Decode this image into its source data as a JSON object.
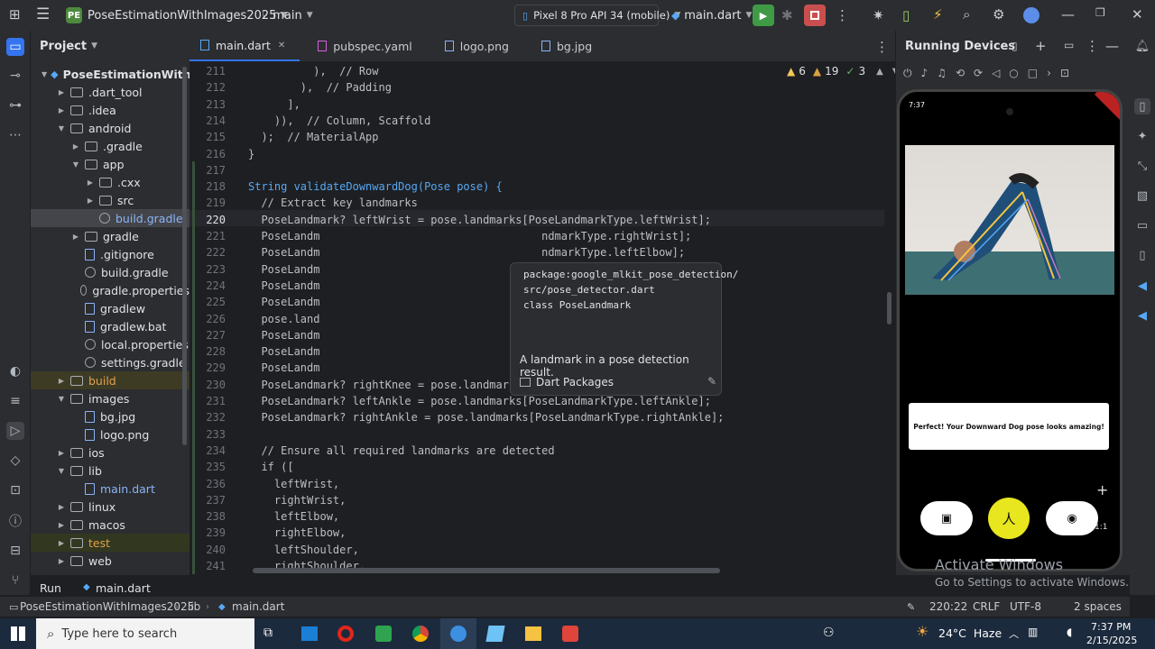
{
  "titlebar": {
    "project_badge": "PE",
    "project_name": "PoseEstimationWithImages2025",
    "branch": "main",
    "device": "Pixel 8 Pro API 34 (mobile)",
    "run_config": "main.dart"
  },
  "project_panel": {
    "title": "Project",
    "root": "PoseEstimationWithIm",
    "items": [
      {
        "label": ".dart_tool",
        "indent": 1,
        "kind": "folder",
        "open": false
      },
      {
        "label": ".idea",
        "indent": 1,
        "kind": "folder",
        "open": false
      },
      {
        "label": "android",
        "indent": 1,
        "kind": "folder",
        "open": true
      },
      {
        "label": ".gradle",
        "indent": 2,
        "kind": "folder",
        "open": false
      },
      {
        "label": "app",
        "indent": 2,
        "kind": "folder",
        "open": true
      },
      {
        "label": ".cxx",
        "indent": 3,
        "kind": "folder",
        "open": false
      },
      {
        "label": "src",
        "indent": 3,
        "kind": "folder",
        "open": false
      },
      {
        "label": "build.gradle",
        "indent": 3,
        "kind": "gradle",
        "open": false
      },
      {
        "label": "gradle",
        "indent": 2,
        "kind": "folder",
        "open": false
      },
      {
        "label": ".gitignore",
        "indent": 2,
        "kind": "file",
        "open": false
      },
      {
        "label": "build.gradle",
        "indent": 2,
        "kind": "gradle",
        "open": false
      },
      {
        "label": "gradle.properties",
        "indent": 2,
        "kind": "gradle",
        "open": false
      },
      {
        "label": "gradlew",
        "indent": 2,
        "kind": "file",
        "open": false
      },
      {
        "label": "gradlew.bat",
        "indent": 2,
        "kind": "file",
        "open": false
      },
      {
        "label": "local.properties",
        "indent": 2,
        "kind": "gradle",
        "open": false
      },
      {
        "label": "settings.gradle",
        "indent": 2,
        "kind": "gradle",
        "open": false
      },
      {
        "label": "build",
        "indent": 1,
        "kind": "folder",
        "open": false
      },
      {
        "label": "images",
        "indent": 1,
        "kind": "folder",
        "open": true
      },
      {
        "label": "bg.jpg",
        "indent": 2,
        "kind": "image",
        "open": false
      },
      {
        "label": "logo.png",
        "indent": 2,
        "kind": "image",
        "open": false
      },
      {
        "label": "ios",
        "indent": 1,
        "kind": "folder",
        "open": false
      },
      {
        "label": "lib",
        "indent": 1,
        "kind": "folder",
        "open": true
      },
      {
        "label": "main.dart",
        "indent": 2,
        "kind": "dart",
        "open": false
      },
      {
        "label": "linux",
        "indent": 1,
        "kind": "folder",
        "open": false
      },
      {
        "label": "macos",
        "indent": 1,
        "kind": "folder",
        "open": false
      },
      {
        "label": "test",
        "indent": 1,
        "kind": "folder",
        "open": false
      },
      {
        "label": "web",
        "indent": 1,
        "kind": "folder",
        "open": false
      }
    ]
  },
  "editor": {
    "tabs": [
      {
        "label": "main.dart",
        "active": true
      },
      {
        "label": "pubspec.yaml",
        "active": false
      },
      {
        "label": "logo.png",
        "active": false
      },
      {
        "label": "bg.jpg",
        "active": false
      }
    ],
    "inspections": {
      "warnings": "6",
      "weak_warnings": "19",
      "typos": "3"
    },
    "lines": [
      {
        "n": "211",
        "code": "          ),  // Row"
      },
      {
        "n": "212",
        "code": "        ),  // Padding"
      },
      {
        "n": "213",
        "code": "      ],"
      },
      {
        "n": "214",
        "code": "    )),  // Column, Scaffold"
      },
      {
        "n": "215",
        "code": "  );  // MaterialApp"
      },
      {
        "n": "216",
        "code": "}"
      },
      {
        "n": "217",
        "code": ""
      },
      {
        "n": "218",
        "code": "String validateDownwardDog(Pose pose) {"
      },
      {
        "n": "219",
        "code": "  // Extract key landmarks"
      },
      {
        "n": "220",
        "code": "  PoseLandmark? leftWrist = pose.landmarks[PoseLandmarkType.leftWrist];"
      },
      {
        "n": "221",
        "code": "  PoseLandm                                  ndmarkType.rightWrist];"
      },
      {
        "n": "222",
        "code": "  PoseLandm                                  ndmarkType.leftElbow];"
      },
      {
        "n": "223",
        "code": "  PoseLandm                                  ndmarkType.rightElbow];"
      },
      {
        "n": "224",
        "code": "  PoseLandm                                   andmarkType.leftShoulder];"
      },
      {
        "n": "225",
        "code": "  PoseLandm"
      },
      {
        "n": "226",
        "code": "  pose.land"
      },
      {
        "n": "227",
        "code": "  PoseLandm                                  Type.leftHip];"
      },
      {
        "n": "228",
        "code": "  PoseLandm                                  rkType.rightHip];"
      },
      {
        "n": "229",
        "code": "  PoseLandm                                   arkType.leftKnee];"
      },
      {
        "n": "230",
        "code": "  PoseLandmark? rightKnee = pose.landmarks[PoseLandmarkType.rightKnee];"
      },
      {
        "n": "231",
        "code": "  PoseLandmark? leftAnkle = pose.landmarks[PoseLandmarkType.leftAnkle];"
      },
      {
        "n": "232",
        "code": "  PoseLandmark? rightAnkle = pose.landmarks[PoseLandmarkType.rightAnkle];"
      },
      {
        "n": "233",
        "code": ""
      },
      {
        "n": "234",
        "code": "  // Ensure all required landmarks are detected"
      },
      {
        "n": "235",
        "code": "  if (["
      },
      {
        "n": "236",
        "code": "    leftWrist,"
      },
      {
        "n": "237",
        "code": "    rightWrist,"
      },
      {
        "n": "238",
        "code": "    leftElbow,"
      },
      {
        "n": "239",
        "code": "    rightElbow,"
      },
      {
        "n": "240",
        "code": "    leftShoulder,"
      },
      {
        "n": "241",
        "code": "    rightShoulder,"
      }
    ],
    "tooltip": {
      "path1": "package:google_mlkit_pose_detection/",
      "path2": "src/pose_detector.dart",
      "decl": "class PoseLandmark",
      "doc": "A landmark in a pose detection result.",
      "link": "Dart Packages"
    }
  },
  "devices_panel": {
    "title": "Running Devices",
    "phone_time": "7:37",
    "result_text": "Perfect! Your Downward Dog pose looks amazing!",
    "zoom_label": "1:1"
  },
  "statusbar": {
    "breadcrumb": [
      "PoseEstimationWithImages2025",
      "lib",
      "main.dart"
    ],
    "position": "220:22",
    "line_sep": "CRLF",
    "encoding": "UTF-8",
    "indent": "2 spaces"
  },
  "runbar": {
    "run_label": "Run",
    "config": "main.dart"
  },
  "activate_windows": {
    "title": "Activate Windows",
    "sub": "Go to Settings to activate Windows."
  },
  "taskbar": {
    "search_placeholder": "Type here to search",
    "weather": "24°C  Haze",
    "time": "7:37 PM",
    "date": "2/15/2025"
  },
  "colors": {
    "accent": "#3574f0",
    "run_green": "#3f9a45",
    "stop_red": "#c94f4f"
  }
}
